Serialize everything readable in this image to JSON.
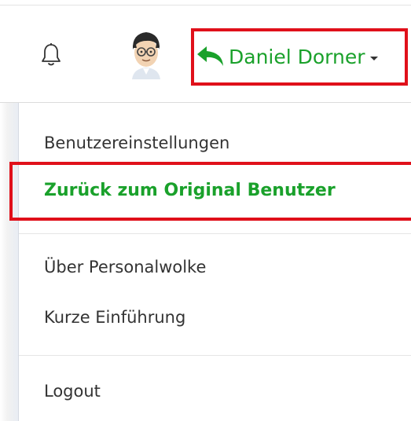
{
  "header": {
    "user_name": "Daniel Dorner",
    "icons": {
      "notifications": "bell-icon",
      "avatar": "avatar-icon",
      "back": "undo-arrow-icon",
      "dropdown": "caret-down-icon"
    },
    "accent_color": "#1aa12b",
    "highlight_color": "#e0101a"
  },
  "dropdown": {
    "items": [
      {
        "label": "Benutzereinstellungen"
      },
      {
        "label": "Zurück zum Original Benutzer",
        "active": true
      },
      {
        "label": "Über Personalwolke"
      },
      {
        "label": "Kurze Einführung"
      },
      {
        "label": "Logout"
      }
    ]
  }
}
